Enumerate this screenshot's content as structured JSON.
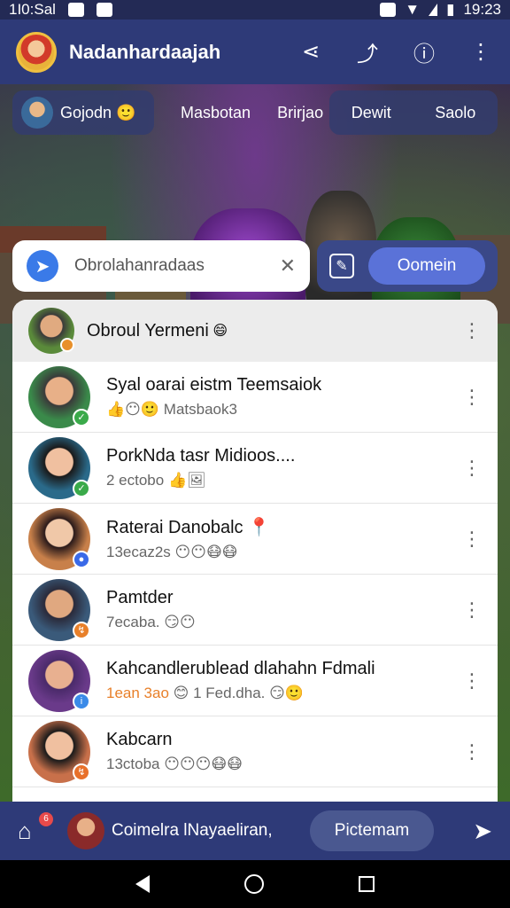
{
  "status_bar": {
    "time_left": "1I0:Sal",
    "time_right": "19:23"
  },
  "app_bar": {
    "title": "Nadanhardaajah"
  },
  "stories": {
    "first_name": "Gojodn",
    "tabs": [
      "Masbotan",
      "Brirjao"
    ],
    "right_tabs": [
      "Dewit",
      "Saolo"
    ]
  },
  "search": {
    "text": "Obrolahanradaas",
    "button_label": "Oomein"
  },
  "group": {
    "title": "Obroul Yermeni"
  },
  "chats": [
    {
      "name": "Syal oarai eistm Teemsaiok",
      "sub": "Matsbaok3",
      "sub_emoji": "👍😶🙂",
      "avatar_color": "#3a8a4a",
      "badge_color": "#3aaa4a"
    },
    {
      "name": "PorkNda tasr Midioos....",
      "sub": "2 ectobo",
      "sub_emoji": "👍🖼",
      "avatar_color": "#2a6a8a",
      "badge_color": "#3aaa4a"
    },
    {
      "name": "Raterai Danobalc",
      "sub": "13ecaz2s",
      "sub_emoji": "😶😶😷😷",
      "avatar_color": "#c8804a",
      "badge_color": "#3a6ae8"
    },
    {
      "name": "Pamtder",
      "sub": "7ecaba.",
      "sub_emoji": "😏😶",
      "avatar_color": "#3a5a7a",
      "badge_color": "#e8802a"
    },
    {
      "name": "Kahcandlerublead dlahahn Fdmali",
      "sub": "1ean 3ao",
      "sub_right": "1 Fed.dha.",
      "sub_emoji": "😊",
      "sub_emoji2": "😏🙂",
      "avatar_color": "#6a3a8a",
      "badge_color": "#3a8ae8"
    },
    {
      "name": "Kabcarn",
      "sub": "13ctoba",
      "sub_emoji": "😶😶😶😷😷",
      "avatar_color": "#c8704a",
      "badge_color": "#e8702a"
    }
  ],
  "bottom_bar": {
    "text": "Coimelra lNayaeliran,",
    "button_label": "Pictemam",
    "badge": "6"
  }
}
